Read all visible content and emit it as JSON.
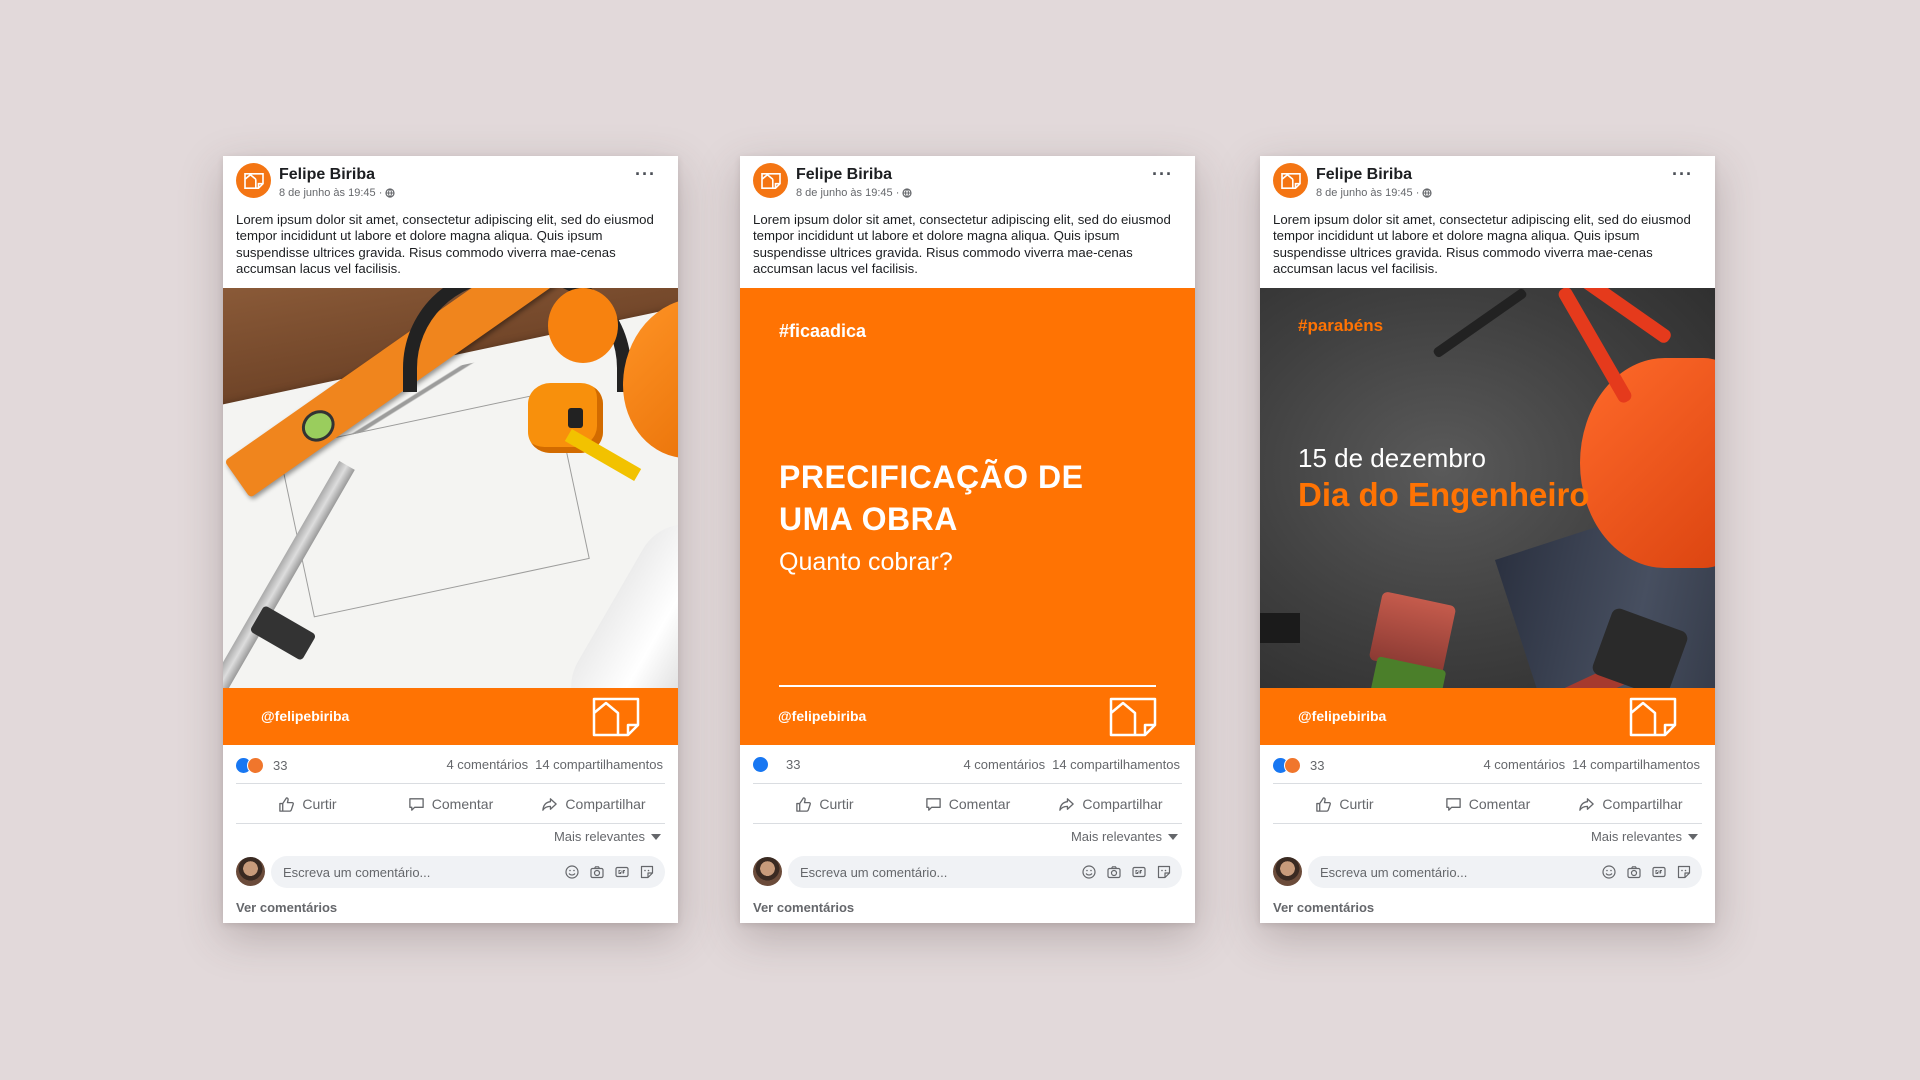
{
  "colors": {
    "brand_orange": "#ff7303",
    "background": "#e2d9da",
    "like_blue": "#1877f2"
  },
  "posts": [
    {
      "author": "Felipe Biriba",
      "timestamp": "8 de junho às 19:45 ·",
      "text": "Lorem ipsum dolor sit amet, consectetur adipiscing elit, sed do eiusmod tempor incididunt ut labore et dolore magna aliqua. Quis ipsum suspendisse ultrices gravida. Risus commodo viverra mae-cenas accumsan lacus vel facilisis.",
      "handle": "@felipebiriba",
      "reaction_count": "33",
      "comments": "4 comentários",
      "shares": "14 compartilhamentos"
    },
    {
      "author": "Felipe Biriba",
      "timestamp": "8 de junho às 19:45 ·",
      "text": "Lorem ipsum dolor sit amet, consectetur adipiscing elit, sed do eiusmod tempor incididunt ut labore et dolore magna aliqua. Quis ipsum suspendisse ultrices gravida. Risus commodo viverra mae-cenas accumsan lacus vel facilisis.",
      "handle": "@felipebiriba",
      "reaction_count": "33",
      "comments": "4 comentários",
      "shares": "14 compartilhamentos",
      "graphic": {
        "tag": "#ficaadica",
        "title_line1": "PRECIFICAÇÃO DE",
        "title_line2": "UMA OBRA",
        "subtitle": "Quanto cobrar?"
      }
    },
    {
      "author": "Felipe Biriba",
      "timestamp": "8 de junho às 19:45 ·",
      "text": "Lorem ipsum dolor sit amet, consectetur adipiscing elit, sed do eiusmod tempor incididunt ut labore et dolore magna aliqua. Quis ipsum suspendisse ultrices gravida. Risus commodo viverra mae-cenas accumsan lacus vel facilisis.",
      "handle": "@felipebiriba",
      "reaction_count": "33",
      "comments": "4 comentários",
      "shares": "14 compartilhamentos",
      "graphic": {
        "tag": "#parabéns",
        "date": "15 de dezembro",
        "title": "Dia do Engenheiro"
      }
    }
  ],
  "actions": {
    "like": "Curtir",
    "comment": "Comentar",
    "share": "Compartilhar"
  },
  "sort_label": "Mais relevantes",
  "comment_placeholder": "Escreva um comentário...",
  "view_comments": "Ver comentários",
  "icons": {
    "more": "more-options-icon",
    "globe": "globe-icon",
    "like": "thumbs-up-icon",
    "comment": "speech-bubble-icon",
    "share": "share-arrow-icon",
    "emoji": "emoji-icon",
    "camera": "camera-icon",
    "gif": "gif-icon",
    "sticker": "sticker-icon",
    "brand": "house-blueprint-logo-icon"
  }
}
